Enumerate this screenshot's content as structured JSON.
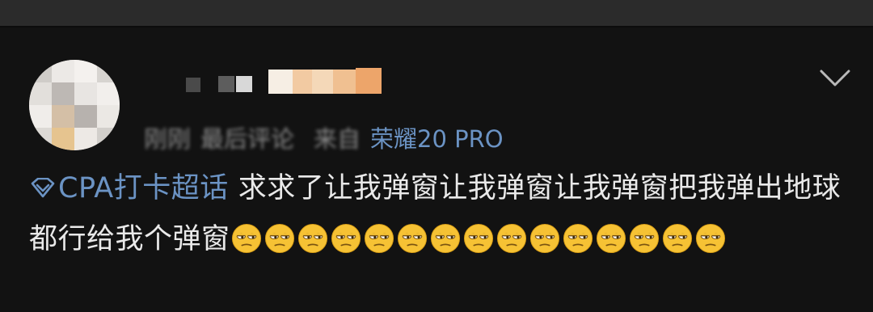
{
  "comment": {
    "meta": {
      "time_blurred": "刚刚",
      "label_blurred": "最后评论",
      "source_prefix": "来自",
      "device": "荣耀20 PRO"
    },
    "topic": {
      "icon": "diamond-icon",
      "label": "CPA打卡超话"
    },
    "text": "求求了让我弹窗让我弹窗让我弹窗把我弹出地球都行给我个弹窗",
    "emoji": {
      "name": "unamused-face-icon",
      "count": 15
    }
  },
  "expand_icon": "chevron-down-icon",
  "colors": {
    "background": "#121212",
    "link": "#6b93c4",
    "text": "#e9e9e9",
    "muted": "#6f6f6f"
  }
}
